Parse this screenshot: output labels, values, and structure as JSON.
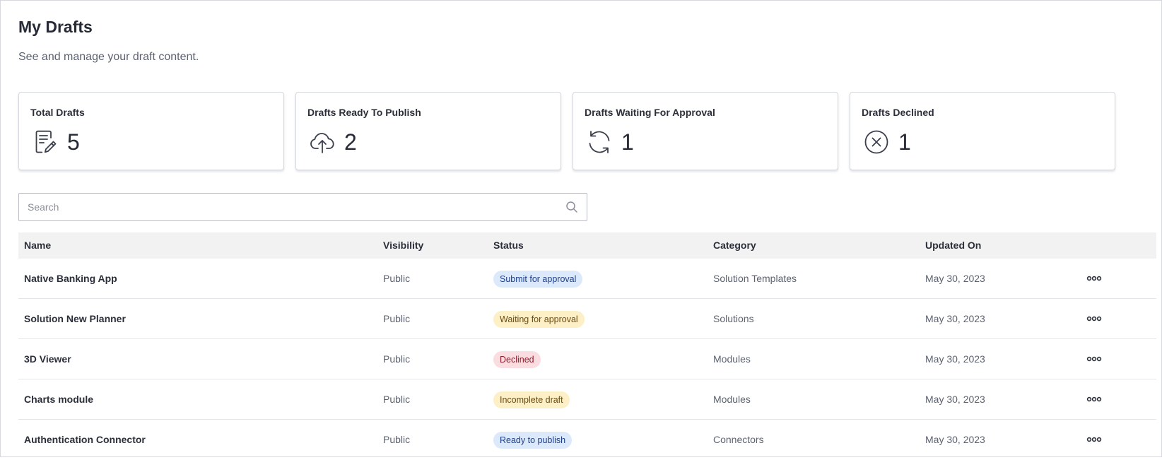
{
  "page": {
    "title": "My Drafts",
    "subtitle": "See and manage your draft content."
  },
  "stats": [
    {
      "label": "Total Drafts",
      "count": "5",
      "icon": "draft-document-icon"
    },
    {
      "label": "Drafts Ready To Publish",
      "count": "2",
      "icon": "cloud-upload-icon"
    },
    {
      "label": "Drafts Waiting For Approval",
      "count": "1",
      "icon": "refresh-icon"
    },
    {
      "label": "Drafts Declined",
      "count": "1",
      "icon": "circle-x-icon"
    }
  ],
  "search": {
    "placeholder": "Search",
    "value": "",
    "icon": "search-icon"
  },
  "table": {
    "columns": {
      "name": "Name",
      "visibility": "Visibility",
      "status": "Status",
      "category": "Category",
      "updated": "Updated On"
    },
    "rows": [
      {
        "name": "Native Banking App",
        "visibility": "Public",
        "status": "Submit for approval",
        "category": "Solution Templates",
        "updated": "May 30, 2023"
      },
      {
        "name": "Solution New Planner",
        "visibility": "Public",
        "status": "Waiting for approval",
        "category": "Solutions",
        "updated": "May 30, 2023"
      },
      {
        "name": "3D Viewer",
        "visibility": "Public",
        "status": "Declined",
        "category": "Modules",
        "updated": "May 30, 2023"
      },
      {
        "name": "Charts module",
        "visibility": "Public",
        "status": "Incomplete draft",
        "category": "Modules",
        "updated": "May 30, 2023"
      },
      {
        "name": "Authentication Connector",
        "visibility": "Public",
        "status": "Ready to publish",
        "category": "Connectors",
        "updated": "May 30, 2023"
      }
    ],
    "more_icon": "more-options-icon"
  },
  "colors": {
    "badge_blue_bg": "#dce9fb",
    "badge_blue_text": "#1f3f8a",
    "badge_yellow_bg": "#fdefc6",
    "badge_yellow_text": "#6b4b10",
    "badge_red_bg": "#fadde1",
    "badge_red_text": "#8a1f2e"
  }
}
